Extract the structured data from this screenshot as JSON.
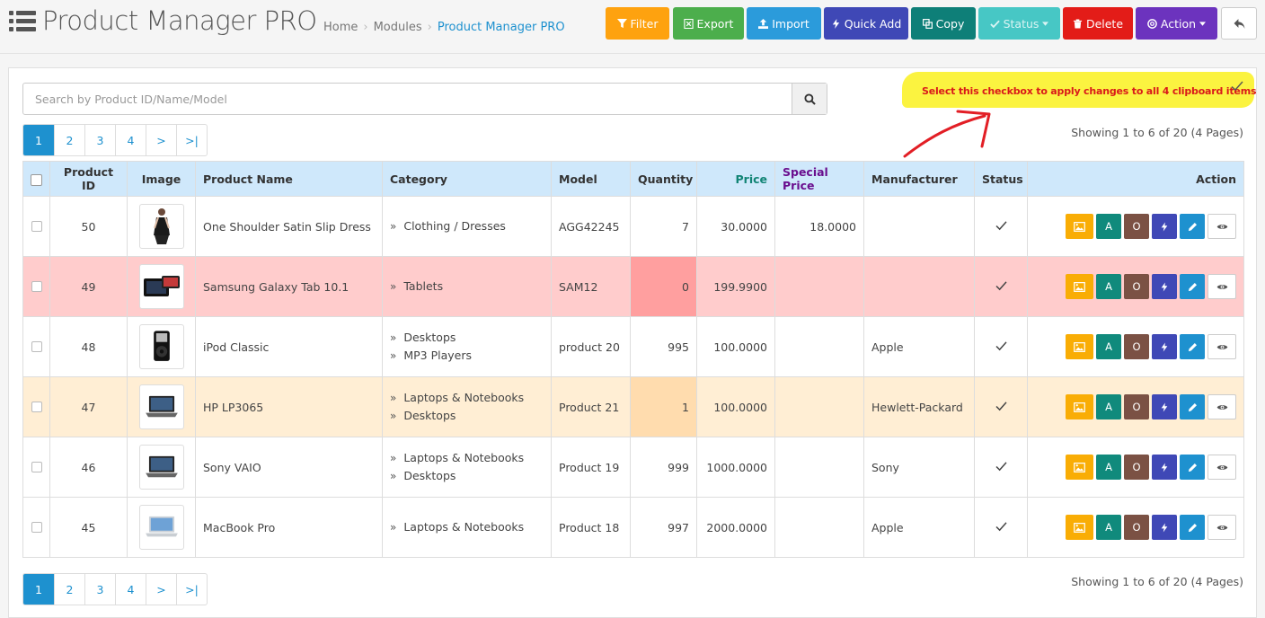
{
  "header": {
    "title": "Product Manager PRO",
    "breadcrumb": [
      "Home",
      "Modules",
      "Product Manager PRO"
    ]
  },
  "toolbar": {
    "filter": "Filter",
    "export": "Export",
    "import": "Import",
    "quick_add": "Quick Add",
    "copy": "Copy",
    "status": "Status",
    "delete": "Delete",
    "action": "Action",
    "colors": {
      "filter": "#fea20f",
      "export": "#4cae4c",
      "import": "#2b9bdb",
      "quick_add": "#3f48b6",
      "copy": "#0e7f78",
      "status": "#47c7c5",
      "delete": "#e31c18",
      "action": "#6c33be"
    }
  },
  "search": {
    "placeholder": "Search by Product ID/Name/Model"
  },
  "annotation": {
    "text": "Select this checkbox to apply changes to all 4 clipboard items"
  },
  "pagination": {
    "pages": [
      "1",
      "2",
      "3",
      "4",
      ">",
      ">|"
    ],
    "active": "1",
    "showing_top": "Showing 1 to 6 of 20 (4 Pages)",
    "showing_bottom": "Showing 1 to 6 of 20 (4 Pages)"
  },
  "table": {
    "columns": {
      "product_id": "Product ID",
      "image": "Image",
      "product_name": "Product Name",
      "category": "Category",
      "model": "Model",
      "quantity": "Quantity",
      "price": "Price",
      "special_price": "Special Price",
      "manufacturer": "Manufacturer",
      "status": "Status",
      "action": "Action"
    },
    "action_labels": {
      "a": "A",
      "o": "O"
    },
    "rows": [
      {
        "id": "50",
        "name": "One Shoulder Satin Slip Dress",
        "categories": [
          "Clothing / Dresses"
        ],
        "model": "AGG42245",
        "quantity": "7",
        "price": "30.0000",
        "special_price": "18.0000",
        "manufacturer": "",
        "image_icon": "dress-image",
        "highlight": "",
        "qty_flag": ""
      },
      {
        "id": "49",
        "name": "Samsung Galaxy Tab 10.1",
        "categories": [
          "Tablets"
        ],
        "model": "SAM12",
        "quantity": "0",
        "price": "199.9900",
        "special_price": "",
        "manufacturer": "",
        "image_icon": "tablet-image",
        "highlight": "red",
        "qty_flag": "zero"
      },
      {
        "id": "48",
        "name": "iPod Classic",
        "categories": [
          "Desktops",
          "MP3 Players"
        ],
        "model": "product 20",
        "quantity": "995",
        "price": "100.0000",
        "special_price": "",
        "manufacturer": "Apple",
        "image_icon": "ipod-image",
        "highlight": "",
        "qty_flag": ""
      },
      {
        "id": "47",
        "name": "HP LP3065",
        "categories": [
          "Laptops & Notebooks",
          "Desktops"
        ],
        "model": "Product 21",
        "quantity": "1",
        "price": "100.0000",
        "special_price": "",
        "manufacturer": "Hewlett-Packard",
        "image_icon": "laptop-image",
        "highlight": "orange",
        "qty_flag": "low"
      },
      {
        "id": "46",
        "name": "Sony VAIO",
        "categories": [
          "Laptops & Notebooks",
          "Desktops"
        ],
        "model": "Product 19",
        "quantity": "999",
        "price": "1000.0000",
        "special_price": "",
        "manufacturer": "Sony",
        "image_icon": "laptop-image",
        "highlight": "",
        "qty_flag": ""
      },
      {
        "id": "45",
        "name": "MacBook Pro",
        "categories": [
          "Laptops & Notebooks"
        ],
        "model": "Product 18",
        "quantity": "997",
        "price": "2000.0000",
        "special_price": "",
        "manufacturer": "Apple",
        "image_icon": "macbook-image",
        "highlight": "",
        "qty_flag": ""
      }
    ]
  }
}
